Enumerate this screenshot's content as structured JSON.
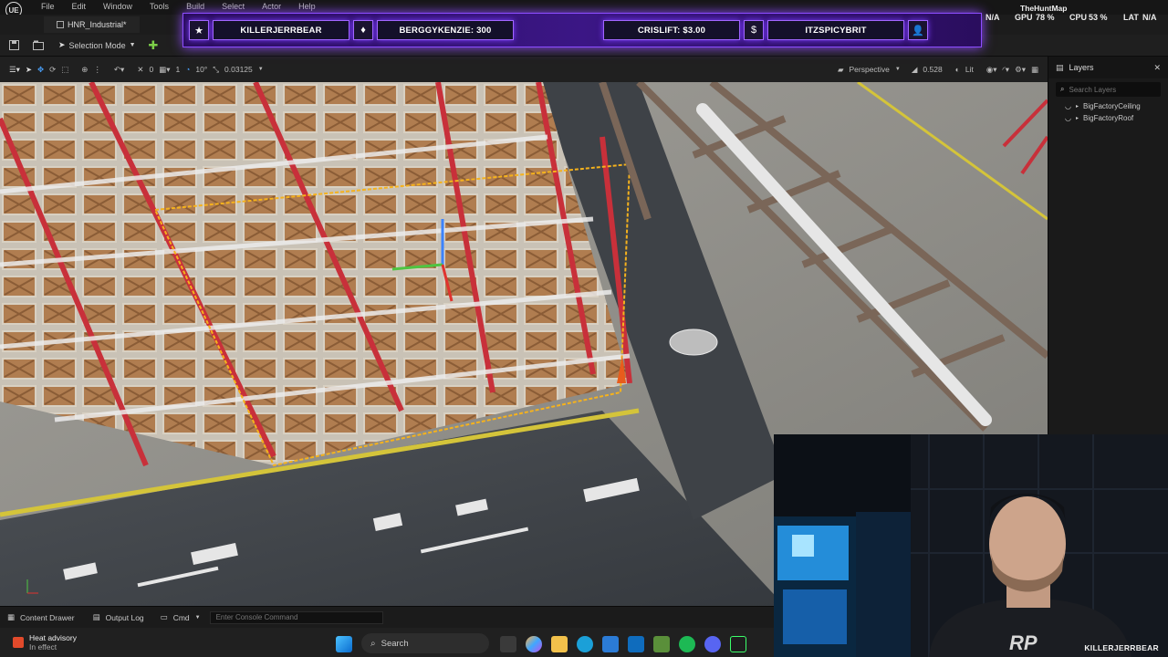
{
  "app": {
    "logo": "UE",
    "level_tab": "HNR_Industrial*"
  },
  "menubar": {
    "items": [
      "File",
      "Edit",
      "Window",
      "Tools",
      "Build",
      "Select",
      "Actor",
      "Help"
    ]
  },
  "toolbar": {
    "selection_mode": "Selection Mode"
  },
  "viewport_toolbar": {
    "angle_snap": "10°",
    "scale_snap": "0.03125",
    "grid_value": "0",
    "rot_value": "1",
    "perspective": "Perspective",
    "fov": "0.528",
    "lit": "Lit"
  },
  "layers_panel": {
    "title": "Layers",
    "search_placeholder": "Search Layers",
    "items": [
      "BigFactoryCeiling",
      "BigFactoryRoof"
    ]
  },
  "stream_overlay": {
    "follower_label": "KILLERJERRBEAR",
    "sub_label": "BERGGYKENZIE: 300",
    "donation_label": "CRISLIFT: $3.00",
    "tip_label": "ITZSPICYBRIT",
    "map_name": "TheHuntMap",
    "gpu_label": "GPU",
    "gpu_value": "78 %",
    "cpu_label": "CPU",
    "cpu_value": "53 %",
    "lat_label": "LAT",
    "lat_value": "N/A",
    "na_left": "N/A"
  },
  "bottombar": {
    "content_drawer": "Content Drawer",
    "output_log": "Output Log",
    "cmd": "Cmd",
    "console_placeholder": "Enter Console Command"
  },
  "taskbar": {
    "weather_title": "Heat advisory",
    "weather_sub": "In effect",
    "search_placeholder": "Search"
  },
  "webcam": {
    "name_tag": "KILLERJERRBEAR",
    "shirt_logo": "RP"
  },
  "colors": {
    "overlay_accent": "#a266ff",
    "selection_outline": "#f5b21d",
    "rack_red": "#c8303a"
  }
}
